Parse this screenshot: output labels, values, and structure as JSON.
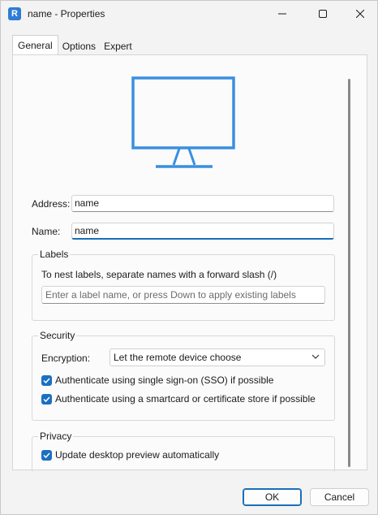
{
  "window": {
    "title": "name - Properties",
    "app_icon_glyph": "R",
    "icons": {
      "minimize": "minimize-icon",
      "maximize": "maximize-icon",
      "close": "close-icon"
    }
  },
  "tabs": [
    {
      "label": "General",
      "active": true
    },
    {
      "label": "Options",
      "active": false
    },
    {
      "label": "Expert",
      "active": false
    }
  ],
  "general": {
    "device_icon": "monitor-icon",
    "address_label": "Address:",
    "address_value": "name",
    "name_label": "Name:",
    "name_value": "name",
    "labels_group": {
      "title": "Labels",
      "hint": "To nest labels, separate names with a forward slash (/)",
      "input_placeholder": "Enter a label name, or press Down to apply existing labels"
    },
    "security_group": {
      "title": "Security",
      "encryption_label": "Encryption:",
      "encryption_value": "Let the remote device choose",
      "sso_label": "Authenticate using single sign-on (SSO) if possible",
      "sso_checked": true,
      "smartcard_label": "Authenticate using a smartcard or certificate store if possible",
      "smartcard_checked": true
    },
    "privacy_group": {
      "title": "Privacy",
      "preview_label": "Update desktop preview automatically",
      "preview_checked": true
    }
  },
  "footer": {
    "ok_label": "OK",
    "cancel_label": "Cancel"
  },
  "colors": {
    "accent": "#1b6fc2",
    "monitor": "#3a8fe0"
  }
}
